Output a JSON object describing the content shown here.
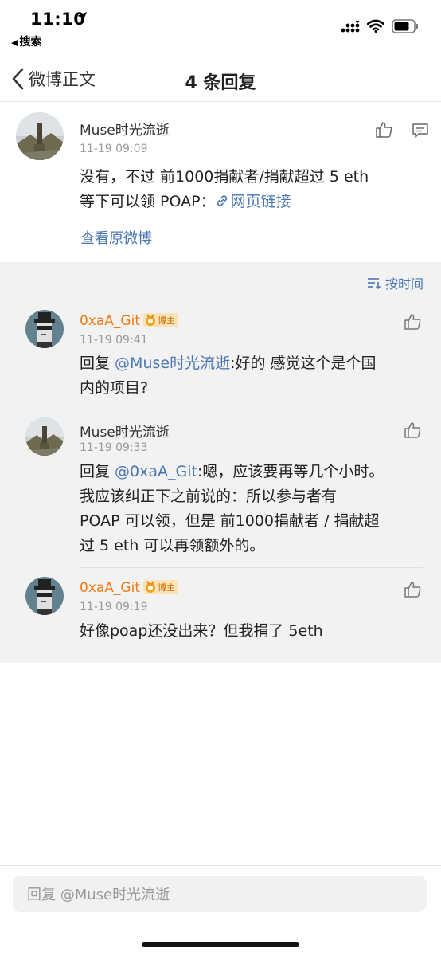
{
  "status_bar": {
    "time": "11:10",
    "back_app_label": "搜索"
  },
  "nav": {
    "back_label": "微博正文",
    "title": "4 条回复"
  },
  "main_comment": {
    "username": "Muse时光流逝",
    "timestamp": "11-19 09:09",
    "line1": "没有，不过 前1000捐献者/捐献超过 5 eth",
    "line2_prefix": "等下可以领 POAP：",
    "link_label": "网页链接",
    "view_original": "查看原微博"
  },
  "sort_label": "按时间",
  "replies": [
    {
      "username": "0xaA_Git",
      "badge": "博主",
      "timestamp": "11-19 09:41",
      "reply_prefix": "回复 ",
      "mention": "@Muse时光流逝",
      "line1_rest": ":好的 感觉这个是个国",
      "line2": "内的项目?"
    },
    {
      "username": "Muse时光流逝",
      "timestamp": "11-19 09:33",
      "reply_prefix": "回复 ",
      "mention": "@0xaA_Git",
      "line1_rest": ":嗯，应该要再等几个小时。",
      "line2": "我应该纠正下之前说的：所以参与者有",
      "line3": "POAP 可以领，但是 前1000捐献者 / 捐献超",
      "line4": "过 5 eth 可以再领额外的。"
    },
    {
      "username": "0xaA_Git",
      "badge": "博主",
      "timestamp": "11-19 09:19",
      "line1": "好像poap还没出来？但我捐了 5eth"
    }
  ],
  "reply_input": {
    "placeholder": "回复 @Muse时光流逝"
  },
  "colors": {
    "link": "#4a77b3",
    "blogger_name": "#f07b15",
    "replies_bg": "#f2f2f2"
  },
  "icons": [
    "location-arrow-icon",
    "signal-icon",
    "wifi-icon",
    "battery-icon",
    "back-chevron-icon",
    "thumbs-up-icon",
    "comment-icon",
    "link-icon",
    "sort-icon",
    "medal-icon"
  ]
}
